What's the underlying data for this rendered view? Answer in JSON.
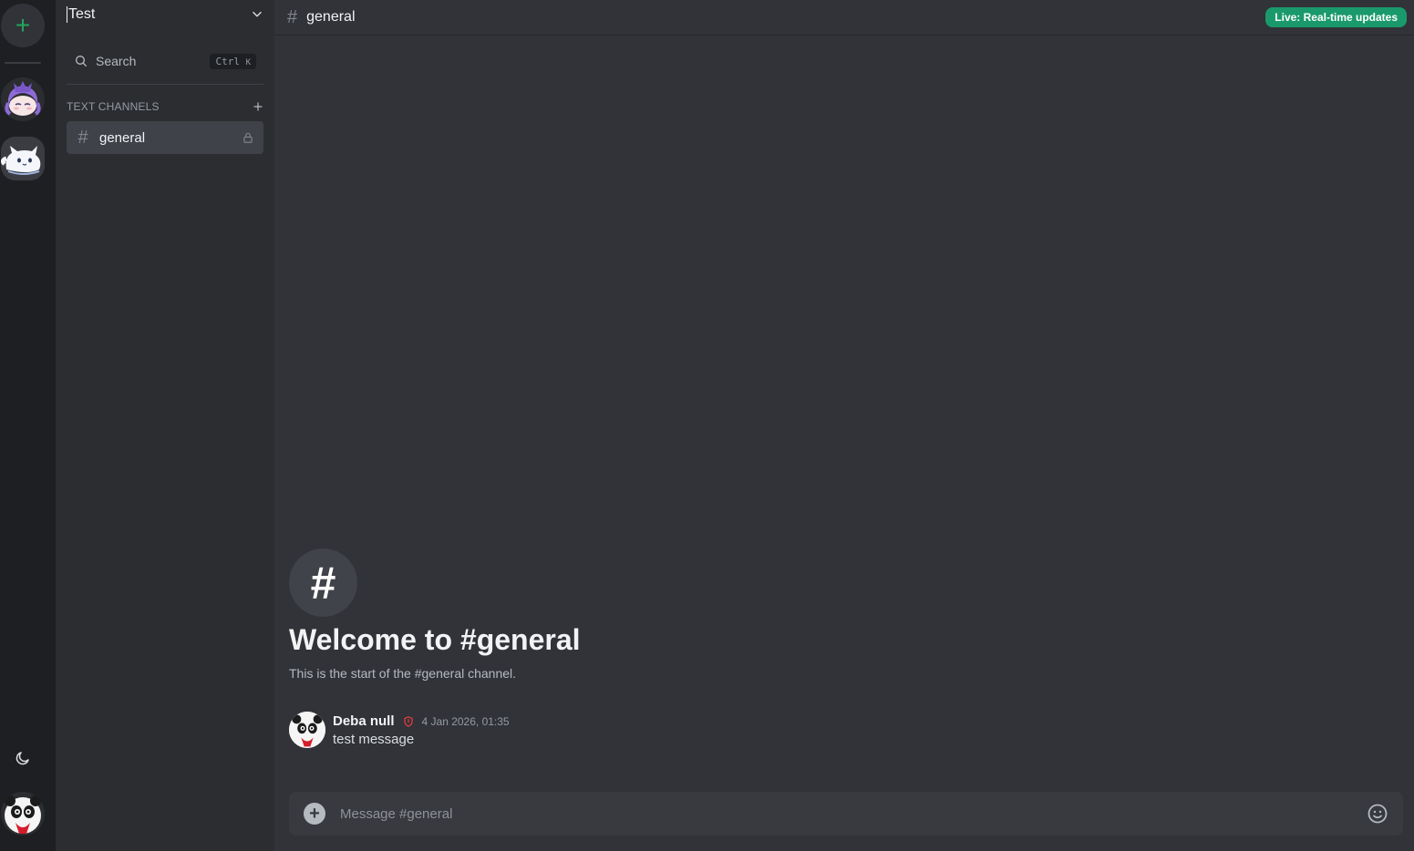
{
  "rail": {
    "add_server_icon": "plus-icon",
    "servers": [
      {
        "name": "purple-hair-avatar"
      },
      {
        "name": "white-cat-avatar"
      }
    ],
    "theme_icon": "moon-icon",
    "user_avatar": "panda-avatar"
  },
  "sidebar": {
    "server_name": "Test",
    "search_label": "Search",
    "search_shortcut_mod": "Ctrl",
    "search_shortcut_key": "K",
    "category_label": "TEXT CHANNELS",
    "channels": [
      {
        "label": "general",
        "locked": true
      }
    ]
  },
  "topbar": {
    "channel_name": "general",
    "live_badge": "Live: Real-time updates"
  },
  "welcome": {
    "icon_glyph": "#",
    "title": "Welcome to #general",
    "subtitle": "This is the start of the #general channel."
  },
  "messages": [
    {
      "author": "Deba null",
      "timestamp": "4 Jan 2026, 01:35",
      "text": "test message"
    }
  ],
  "composer": {
    "placeholder": "Message #general"
  },
  "colors": {
    "accent_green": "#23a55a",
    "live_badge": "#1a9a6c",
    "moderator_shield": "#f23f43"
  }
}
